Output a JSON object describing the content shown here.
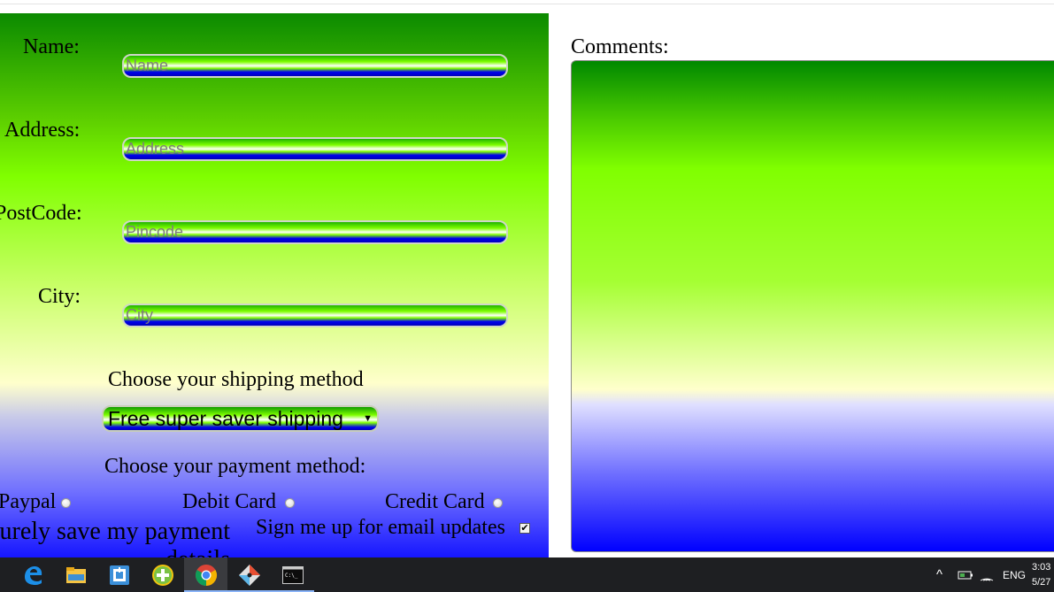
{
  "form": {
    "name_label": "Name:",
    "name_placeholder": "Name",
    "address_label": "Address:",
    "address_placeholder": "Address",
    "postcode_label": "PostCode:",
    "postcode_placeholder": "Pincode",
    "city_label": "City:",
    "city_placeholder": "City",
    "shipping_heading": "Choose your shipping method",
    "shipping_selected": "Free super saver shipping",
    "payment_heading": "Choose your payment method:",
    "payment_options": [
      "Paypal",
      "Debit Card",
      "Credit Card"
    ],
    "save_payment_label": "Securely save my payment details",
    "email_updates_label": "Sign me up for email updates",
    "email_updates_checked": true
  },
  "comments": {
    "label": "Comments:"
  },
  "taskbar": {
    "apps": [
      "edge-icon",
      "file-explorer-icon",
      "app-icon",
      "cd-icon",
      "chrome-icon",
      "git-icon",
      "terminal-icon"
    ],
    "language": "ENG",
    "time": "3:03",
    "date": "5/27"
  },
  "colors": {
    "taskbar_bg": "#1e1f22",
    "gradient_green": "#80ff00",
    "gradient_blue": "#0000ff"
  }
}
